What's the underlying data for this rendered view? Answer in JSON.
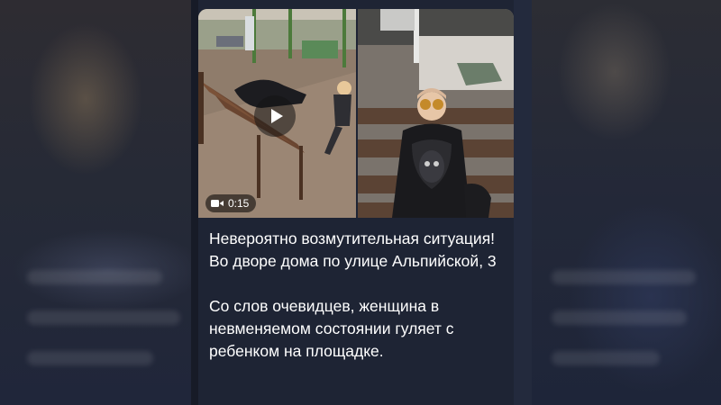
{
  "video": {
    "duration": "0:15",
    "camera_icon": "video-camera-icon",
    "play_icon": "play-icon"
  },
  "post": {
    "paragraph1": "Невероятно возмутительная ситуация! Во дворе дома по улице Альпийской, 3",
    "paragraph2": "Со слов очевидцев, женщина в невменяемом состоянии гуляет с ребенком на площадке."
  },
  "colors": {
    "background": "#1b1f2c",
    "card": "#1e2434",
    "text": "#ffffff"
  }
}
